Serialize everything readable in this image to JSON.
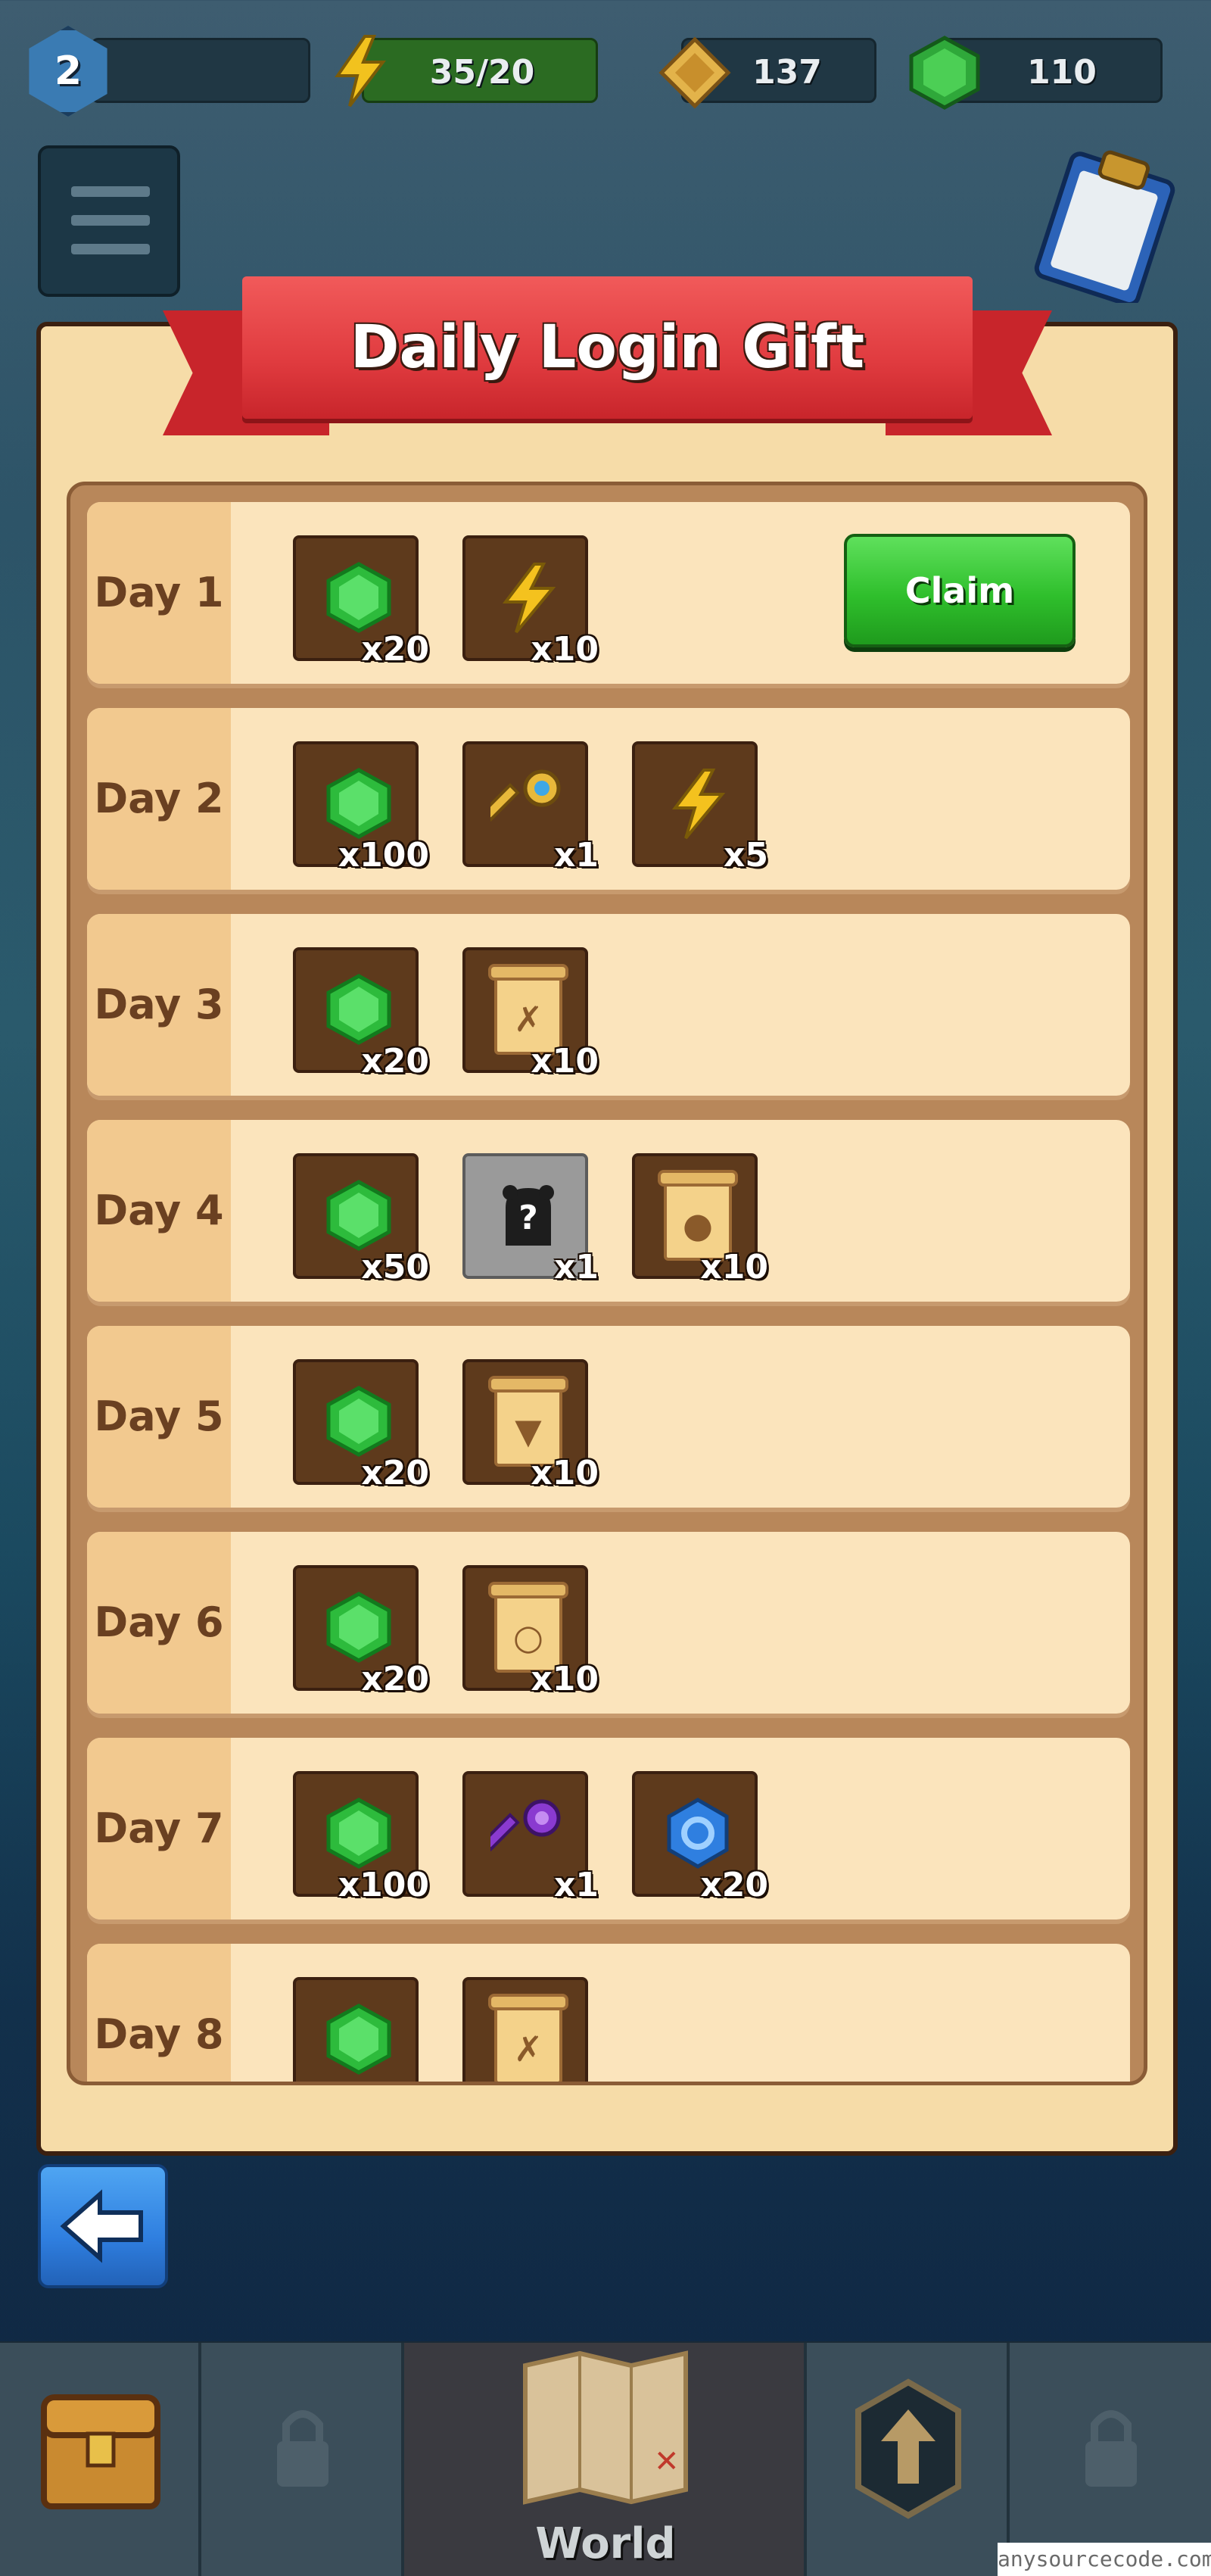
{
  "hud": {
    "level": "2",
    "energy": "35/20",
    "scrolls": "137",
    "gems": "110"
  },
  "dialog": {
    "title": "Daily Login Gift",
    "claim_label": "Claim",
    "days": [
      {
        "label": "Day 1",
        "rewards": [
          {
            "icon": "gem-icon",
            "qty": "x20"
          },
          {
            "icon": "lightning-icon",
            "qty": "x10"
          }
        ]
      },
      {
        "label": "Day 2",
        "rewards": [
          {
            "icon": "gem-icon",
            "qty": "x100"
          },
          {
            "icon": "gold-key-icon",
            "qty": "x1"
          },
          {
            "icon": "lightning-icon",
            "qty": "x5"
          }
        ]
      },
      {
        "label": "Day 3",
        "rewards": [
          {
            "icon": "gem-icon",
            "qty": "x20"
          },
          {
            "icon": "bow-scroll-icon",
            "qty": "x10"
          }
        ]
      },
      {
        "label": "Day 4",
        "rewards": [
          {
            "icon": "gem-icon",
            "qty": "x50"
          },
          {
            "icon": "mystery-pet-icon",
            "qty": "x1"
          },
          {
            "icon": "paw-scroll-icon",
            "qty": "x10"
          }
        ]
      },
      {
        "label": "Day 5",
        "rewards": [
          {
            "icon": "gem-icon",
            "qty": "x20"
          },
          {
            "icon": "armor-scroll-icon",
            "qty": "x10"
          }
        ]
      },
      {
        "label": "Day 6",
        "rewards": [
          {
            "icon": "gem-icon",
            "qty": "x20"
          },
          {
            "icon": "ring-scroll-icon",
            "qty": "x10"
          }
        ]
      },
      {
        "label": "Day 7",
        "rewards": [
          {
            "icon": "gem-icon",
            "qty": "x100"
          },
          {
            "icon": "purple-key-icon",
            "qty": "x1"
          },
          {
            "icon": "blue-crystal-icon",
            "qty": "x20"
          }
        ]
      },
      {
        "label": "Day 8",
        "rewards": [
          {
            "icon": "gem-icon",
            "qty": ""
          },
          {
            "icon": "bow-scroll-icon",
            "qty": ""
          }
        ]
      }
    ]
  },
  "bottom_nav": {
    "world_label": "World"
  },
  "watermark": "anysourcecode.com",
  "colors": {
    "claim_green": "#2fbf2c",
    "ribbon_red": "#e03b3f",
    "panel_parchment": "#f6dca8",
    "back_blue": "#2f7fe0"
  }
}
